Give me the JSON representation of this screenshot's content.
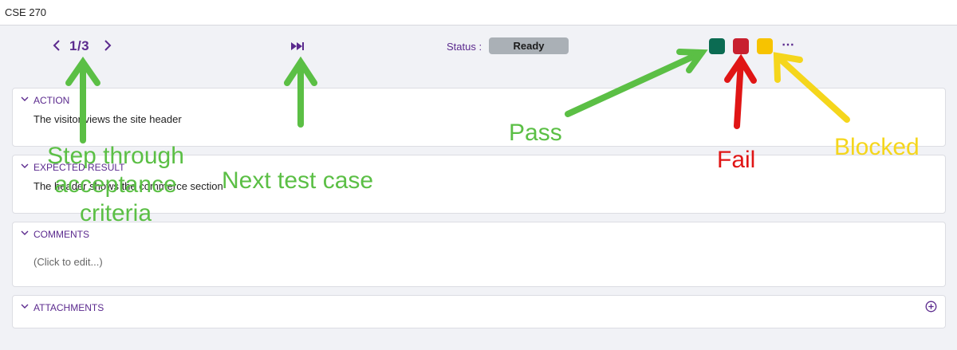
{
  "window": {
    "title": "CSE 270"
  },
  "toolbar": {
    "step_counter": "1/3",
    "status_label": "Status :",
    "status_value": "Ready",
    "more_label": "⋯",
    "result_colors": {
      "pass": "#0b6b52",
      "fail": "#c8202f",
      "blocked": "#f7c300"
    }
  },
  "sections": {
    "action": {
      "title": "ACTION",
      "text": "The visitor views the site header"
    },
    "expected": {
      "title": "EXPECTED RESULT",
      "text": "The header shows the commerce section"
    },
    "comments": {
      "title": "COMMENTS",
      "placeholder": "(Click to edit...)"
    },
    "attachments": {
      "title": "ATTACHMENTS"
    }
  },
  "annotations": {
    "step": [
      "Step through",
      "acceptance",
      "criteria"
    ],
    "next": "Next test case",
    "pass": "Pass",
    "fail": "Fail",
    "blocked": "Blocked",
    "colors": {
      "green": "#5bbf45",
      "red": "#e01515",
      "yellow": "#f5d61c"
    }
  }
}
